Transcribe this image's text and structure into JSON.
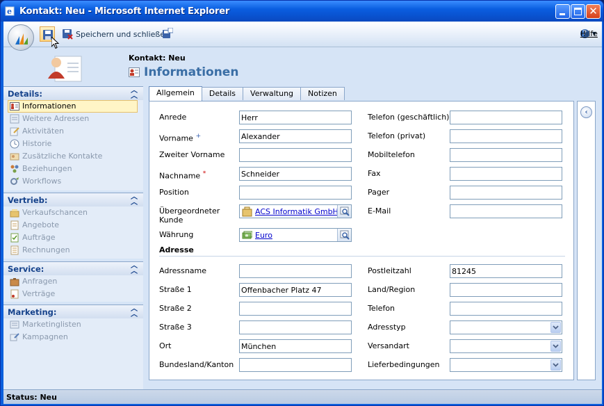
{
  "window": {
    "title": "Kontakt: Neu - Microsoft Internet Explorer"
  },
  "toolbar": {
    "save_close_label": "Speichern und schließen",
    "help_label": "Hilfe"
  },
  "header": {
    "subtitle": "Kontakt: Neu",
    "title": "Informationen"
  },
  "sidebar": {
    "sections": [
      {
        "title": "Details:",
        "items": [
          "Informationen",
          "Weitere Adressen",
          "Aktivitäten",
          "Historie",
          "Zusätzliche Kontakte",
          "Beziehungen",
          "Workflows"
        ]
      },
      {
        "title": "Vertrieb:",
        "items": [
          "Verkaufschancen",
          "Angebote",
          "Aufträge",
          "Rechnungen"
        ]
      },
      {
        "title": "Service:",
        "items": [
          "Anfragen",
          "Verträge"
        ]
      },
      {
        "title": "Marketing:",
        "items": [
          "Marketinglisten",
          "Kampagnen"
        ]
      }
    ]
  },
  "tabs": [
    "Allgemein",
    "Details",
    "Verwaltung",
    "Notizen"
  ],
  "form": {
    "left": [
      {
        "label": "Anrede",
        "value": "Herr"
      },
      {
        "label": "Vorname",
        "value": "Alexander"
      },
      {
        "label": "Zweiter Vorname",
        "value": ""
      },
      {
        "label": "Nachname",
        "value": "Schneider"
      },
      {
        "label": "Position",
        "value": ""
      },
      {
        "label": "Übergeordneter Kunde",
        "value": "ACS Informatik GmbH"
      },
      {
        "label": "Währung",
        "value": "Euro"
      }
    ],
    "right": [
      {
        "label": "Telefon (geschäftlich)",
        "value": ""
      },
      {
        "label": "Telefon (privat)",
        "value": ""
      },
      {
        "label": "Mobiltelefon",
        "value": ""
      },
      {
        "label": "Fax",
        "value": ""
      },
      {
        "label": "Pager",
        "value": ""
      },
      {
        "label": "E-Mail",
        "value": ""
      }
    ],
    "required_marker": "*",
    "recommended_marker": "+",
    "address_title": "Adresse",
    "address_left": [
      {
        "label": "Adressname",
        "value": ""
      },
      {
        "label": "Straße 1",
        "value": "Offenbacher Platz 47"
      },
      {
        "label": "Straße 2",
        "value": ""
      },
      {
        "label": "Straße 3",
        "value": ""
      },
      {
        "label": "Ort",
        "value": "München"
      },
      {
        "label": "Bundesland/Kanton",
        "value": ""
      }
    ],
    "address_right": [
      {
        "label": "Postleitzahl",
        "value": "81245"
      },
      {
        "label": "Land/Region",
        "value": ""
      },
      {
        "label": "Telefon",
        "value": ""
      },
      {
        "label": "Adresstyp",
        "value": ""
      },
      {
        "label": "Versandart",
        "value": ""
      },
      {
        "label": "Lieferbedingungen",
        "value": ""
      }
    ]
  },
  "status": {
    "text": "Status: Neu"
  },
  "colors": {
    "title_bar": "#0a5ee0",
    "accent": "#3a6ea5",
    "section_head": "#15428b",
    "required": "#cc0000"
  }
}
